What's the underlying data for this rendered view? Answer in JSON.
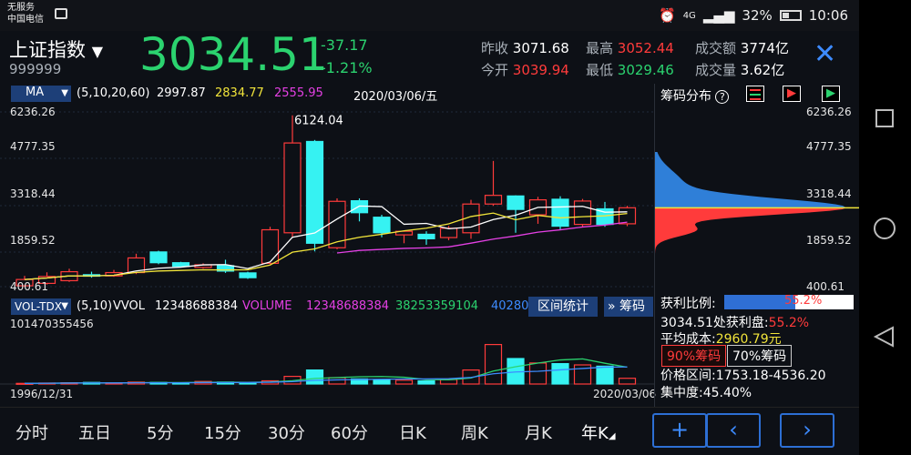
{
  "status_bar": {
    "carrier_line1": "无服务",
    "carrier_line2": "中国电信",
    "signal_label": "4G",
    "battery": "32%",
    "time": "10:06"
  },
  "header": {
    "index_name": "上证指数",
    "index_code": "999999",
    "price": "3034.51",
    "change": "-37.17",
    "change_pct": "-1.21%",
    "prev_close_label": "昨收",
    "prev_close": "3071.68",
    "open_label": "今开",
    "open": "3039.94",
    "high_label": "最高",
    "high": "3052.44",
    "low_label": "最低",
    "low": "3029.46",
    "turnover_label": "成交额",
    "turnover": "3774亿",
    "volume_label": "成交量",
    "volume": "3.62亿"
  },
  "colors": {
    "up": "#ff3b3b",
    "down": "#36f2f2",
    "ma5": "#ffffff",
    "ma10": "#f1e43a",
    "ma20": "#e440e4",
    "ma60": "#2bd36f",
    "chip_profit": "#ff3b3b",
    "chip_loss": "#2f7fd8"
  },
  "ma_bar": {
    "indicator": "MA",
    "params": "(5,10,20,60)",
    "ma5": "2997.87",
    "ma10": "2834.77",
    "ma20": "2555.95",
    "date": "2020/03/06/五"
  },
  "kline": {
    "y_labels": [
      "6236.26",
      "4777.35",
      "3318.44",
      "1859.52",
      "400.61"
    ],
    "max_marker": "6124.04"
  },
  "vol_bar": {
    "indicator": "VOL-TDX",
    "params": "(5,10)",
    "vvol_label": "VVOL",
    "vvol": "12348688384",
    "volume_label": "VOLUME",
    "volume": "12348688384",
    "ma5": "38253359104",
    "ma10": "40280",
    "range_stat": "区间统计",
    "chips_btn": "筹码"
  },
  "volume_chart": {
    "y_max_label": "101470355456",
    "start_date": "1996/12/31",
    "end_date": "2020/03/06"
  },
  "chip_panel": {
    "title": "筹码分布",
    "help": "?",
    "y_labels": [
      "6236.26",
      "4777.35",
      "3318.44",
      "1859.52",
      "400.61"
    ],
    "profit_ratio_label": "获利比例:",
    "profit_ratio": "55.2%",
    "profit_ratio_value": 0.552,
    "price_profit_label": "3034.51处获利盘:",
    "price_profit": "55.2%",
    "avg_cost_label": "平均成本:",
    "avg_cost": "2960.79元",
    "chips90": "90%筹码",
    "chips70": "70%筹码",
    "range_label": "价格区间:",
    "range": "1753.18-4536.20",
    "concentration_label": "集中度:",
    "concentration": "45.40%"
  },
  "periods": [
    "分时",
    "五日",
    "5分",
    "15分",
    "30分",
    "60分",
    "日K",
    "周K",
    "月K",
    "年K"
  ],
  "nav_buttons": {
    "add": "+",
    "prev": "‹",
    "next": "›",
    "close": "✕"
  },
  "chart_data": {
    "type": "candlestick",
    "series": [
      {
        "name": "K",
        "candles": [
          {
            "o": 430,
            "c": 640,
            "h": 760,
            "l": 390
          },
          {
            "o": 510,
            "c": 740,
            "h": 880,
            "l": 470
          },
          {
            "o": 600,
            "c": 900,
            "h": 1000,
            "l": 560
          },
          {
            "o": 800,
            "c": 750,
            "h": 900,
            "l": 700
          },
          {
            "o": 760,
            "c": 870,
            "h": 960,
            "l": 730
          },
          {
            "o": 870,
            "c": 1360,
            "h": 1500,
            "l": 820
          },
          {
            "o": 1560,
            "c": 1200,
            "h": 1600,
            "l": 1150
          },
          {
            "o": 1200,
            "c": 1080,
            "h": 1230,
            "l": 1050
          },
          {
            "o": 1040,
            "c": 1130,
            "h": 1180,
            "l": 1000
          },
          {
            "o": 1100,
            "c": 920,
            "h": 1300,
            "l": 860
          },
          {
            "o": 860,
            "c": 700,
            "h": 900,
            "l": 660
          },
          {
            "o": 1180,
            "c": 2300,
            "h": 2400,
            "l": 1150
          },
          {
            "o": 2200,
            "c": 5200,
            "h": 6124,
            "l": 2050
          },
          {
            "o": 5250,
            "c": 1850,
            "h": 5300,
            "l": 1580
          },
          {
            "o": 1700,
            "c": 3250,
            "h": 3350,
            "l": 1650
          },
          {
            "o": 3270,
            "c": 2870,
            "h": 3350,
            "l": 2580
          },
          {
            "o": 2720,
            "c": 2200,
            "h": 2800,
            "l": 2050
          },
          {
            "o": 2130,
            "c": 2250,
            "h": 2270,
            "l": 1850
          },
          {
            "o": 2150,
            "c": 2000,
            "h": 2250,
            "l": 1800
          },
          {
            "o": 2040,
            "c": 2350,
            "h": 2430,
            "l": 1950
          },
          {
            "o": 2200,
            "c": 3160,
            "h": 3300,
            "l": 2000
          },
          {
            "o": 3160,
            "c": 3450,
            "h": 4600,
            "l": 3100
          },
          {
            "o": 3430,
            "c": 2980,
            "h": 3450,
            "l": 2200
          },
          {
            "o": 2800,
            "c": 3300,
            "h": 3400,
            "l": 2500
          },
          {
            "o": 3320,
            "c": 2420,
            "h": 3420,
            "l": 2300
          },
          {
            "o": 2480,
            "c": 3260,
            "h": 3330,
            "l": 2400
          },
          {
            "o": 3000,
            "c": 2480,
            "h": 3230,
            "l": 2400
          },
          {
            "o": 2500,
            "c": 3035,
            "h": 3100,
            "l": 2420
          }
        ]
      }
    ],
    "ylim": [
      400.61,
      6236.26
    ],
    "volume_ylim": [
      0,
      101470355456
    ],
    "volume": [
      0.01,
      0.015,
      0.02,
      0.025,
      0.015,
      0.03,
      0.025,
      0.02,
      0.04,
      0.03,
      0.02,
      0.05,
      0.12,
      0.22,
      0.1,
      0.08,
      0.07,
      0.06,
      0.05,
      0.07,
      0.22,
      0.62,
      0.4,
      0.33,
      0.32,
      0.3,
      0.28,
      0.09
    ],
    "chip_distribution": {
      "price_min": 400.61,
      "price_max": 6236.26,
      "current_price": 3034.51
    }
  }
}
